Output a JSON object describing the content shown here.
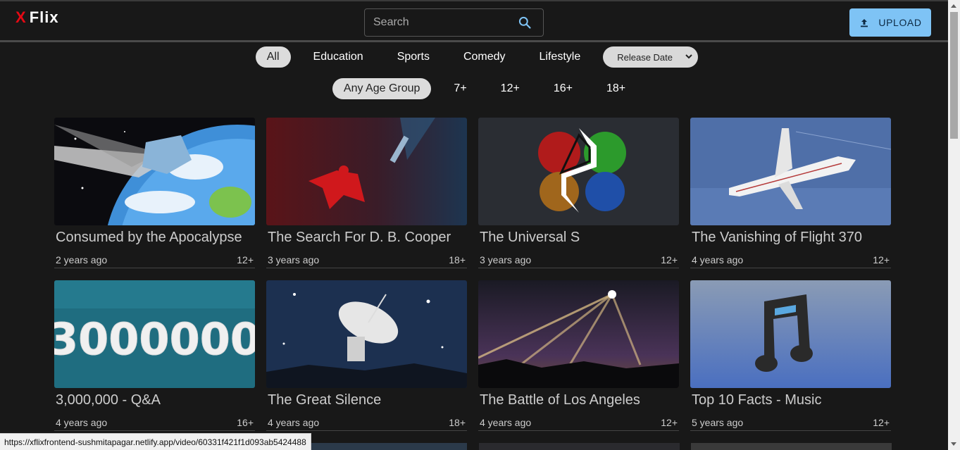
{
  "header": {
    "logo_x": "X",
    "logo_text": "Flix",
    "search_placeholder": "Search",
    "upload_label": "UPLOAD"
  },
  "genres": [
    {
      "label": "All",
      "active": true
    },
    {
      "label": "Education",
      "active": false
    },
    {
      "label": "Sports",
      "active": false
    },
    {
      "label": "Comedy",
      "active": false
    },
    {
      "label": "Lifestyle",
      "active": false
    }
  ],
  "sort": {
    "selected": "Release Date"
  },
  "ages": [
    {
      "label": "Any Age Group",
      "active": true
    },
    {
      "label": "7+",
      "active": false
    },
    {
      "label": "12+",
      "active": false
    },
    {
      "label": "16+",
      "active": false
    },
    {
      "label": "18+",
      "active": false
    }
  ],
  "videos": [
    {
      "title": "Consumed by the Apocalypse",
      "date": "2 years ago",
      "age": "12+"
    },
    {
      "title": "The Search For D. B. Cooper",
      "date": "3 years ago",
      "age": "18+"
    },
    {
      "title": "The Universal S",
      "date": "3 years ago",
      "age": "12+"
    },
    {
      "title": "The Vanishing of Flight 370",
      "date": "4 years ago",
      "age": "12+"
    },
    {
      "title": "3,000,000 - Q&A",
      "date": "4 years ago",
      "age": "16+",
      "thumb_text": "3000000"
    },
    {
      "title": "The Great Silence",
      "date": "4 years ago",
      "age": "18+"
    },
    {
      "title": "The Battle of Los Angeles",
      "date": "4 years ago",
      "age": "12+"
    },
    {
      "title": "Top 10 Facts - Music",
      "date": "5 years ago",
      "age": "12+"
    }
  ],
  "status_url": "https://xflixfrontend-sushmitapagar.netlify.app/video/60331f421f1d093ab5424488",
  "colors": {
    "accent": "#7ec3f5",
    "brand": "#e50914",
    "background": "#181818"
  }
}
